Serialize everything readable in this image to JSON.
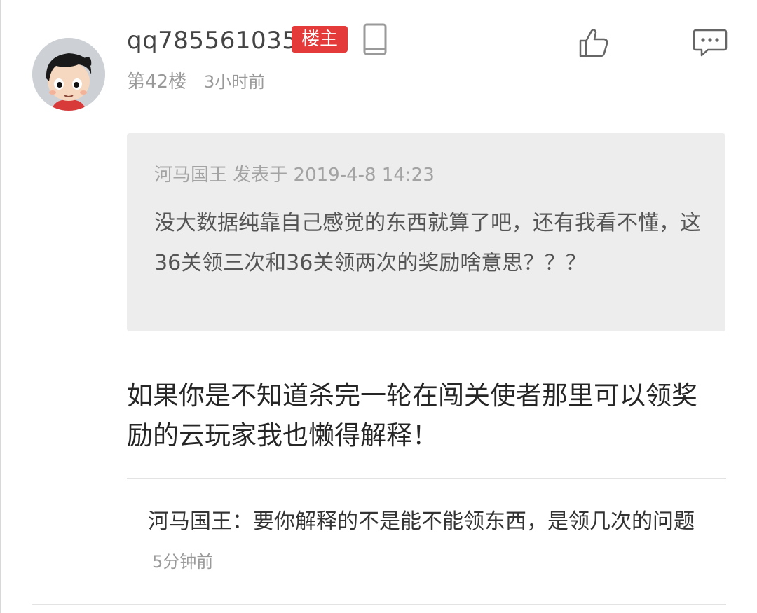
{
  "post": {
    "username": "qq785561035",
    "op_badge": "楼主",
    "floor": "第42楼",
    "time": "3小时前",
    "icons": {
      "device": "phone-icon",
      "like": "thumbs-up-icon",
      "comment": "comment-icon"
    }
  },
  "quote": {
    "meta": "河马国王 发表于 2019-4-8 14:23",
    "text": "没大数据纯靠自己感觉的东西就算了吧，还有我看不懂，这36关领三次和36关领两次的奖励啥意思？？？"
  },
  "reply": {
    "text": "如果你是不知道杀完一轮在闯关使者那里可以领奖励的云玩家我也懒得解释！"
  },
  "subreply": {
    "text": "河马国王：要你解释的不是能不能领东西，是领几次的问题",
    "time": "5分钟前"
  },
  "colors": {
    "badge": "#e43a3a",
    "quote_bg": "#ededed",
    "muted": "#999999"
  }
}
